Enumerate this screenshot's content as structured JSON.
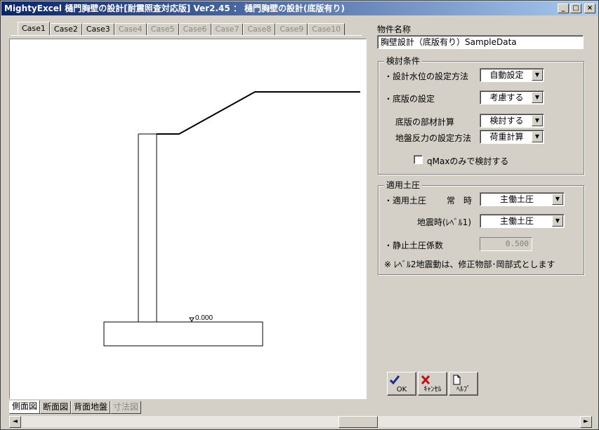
{
  "window": {
    "title": "MightyExcel 樋門胸壁の設計[耐震照査対応版] Ver2.45 ： 樋門胸壁の設計(底版有り)",
    "min_glyph": "_",
    "max_glyph": "□",
    "close_glyph": "×"
  },
  "case_tabs": [
    {
      "label": "Case1",
      "enabled": true
    },
    {
      "label": "Case2",
      "enabled": true
    },
    {
      "label": "Case3",
      "enabled": true
    },
    {
      "label": "Case4",
      "enabled": false
    },
    {
      "label": "Case5",
      "enabled": false
    },
    {
      "label": "Case6",
      "enabled": false
    },
    {
      "label": "Case7",
      "enabled": false
    },
    {
      "label": "Case8",
      "enabled": false
    },
    {
      "label": "Case9",
      "enabled": false
    },
    {
      "label": "Case10",
      "enabled": false
    }
  ],
  "drawing": {
    "water_level_label": "0.000"
  },
  "view_tabs": [
    {
      "label": "側面図",
      "enabled": true
    },
    {
      "label": "断面図",
      "enabled": true
    },
    {
      "label": "背面地盤",
      "enabled": true
    },
    {
      "label": "寸法図",
      "enabled": false
    }
  ],
  "scrollbar": {
    "left_arrow": "◄",
    "right_arrow": "►"
  },
  "property": {
    "label": "物件名称",
    "value": "胸壁設計（底版有り）SampleData"
  },
  "conditions": {
    "title": "検討条件",
    "water_level_method_label": "・設計水位の設定方法",
    "water_level_method_value": "自動設定",
    "base_setting_label": "・底版の設定",
    "base_setting_value": "考慮する",
    "base_member_calc_label": "底版の部材計算",
    "base_member_calc_value": "検討する",
    "ground_reaction_label": "地盤反力の設定方法",
    "ground_reaction_value": "荷重計算",
    "qmax_only_label": "qMaxのみで検討する",
    "qmax_only_checked": false
  },
  "earth_pressure": {
    "title": "適用土圧",
    "applied_label": "・適用土圧",
    "normal_label": "常　時",
    "normal_value": "主働土圧",
    "seismic_label": "地震時(ﾚﾍﾞﾙ1)",
    "seismic_value": "主働土圧",
    "rest_coeff_label": "・静止土圧係数",
    "rest_coeff_value": "0.500",
    "note": "※ ﾚﾍﾞﾙ2地震動は、修正物部･岡部式とします"
  },
  "buttons": {
    "ok": "OK",
    "cancel": "ｷｬﾝｾﾙ",
    "help": "ﾍﾙﾌﾟ"
  },
  "dropdown_arrow": "▼",
  "colors": {
    "title_start": "#0a246a",
    "title_end": "#a6caf0",
    "ok_icon": "#1a2c8c",
    "cancel_icon": "#c01010"
  }
}
